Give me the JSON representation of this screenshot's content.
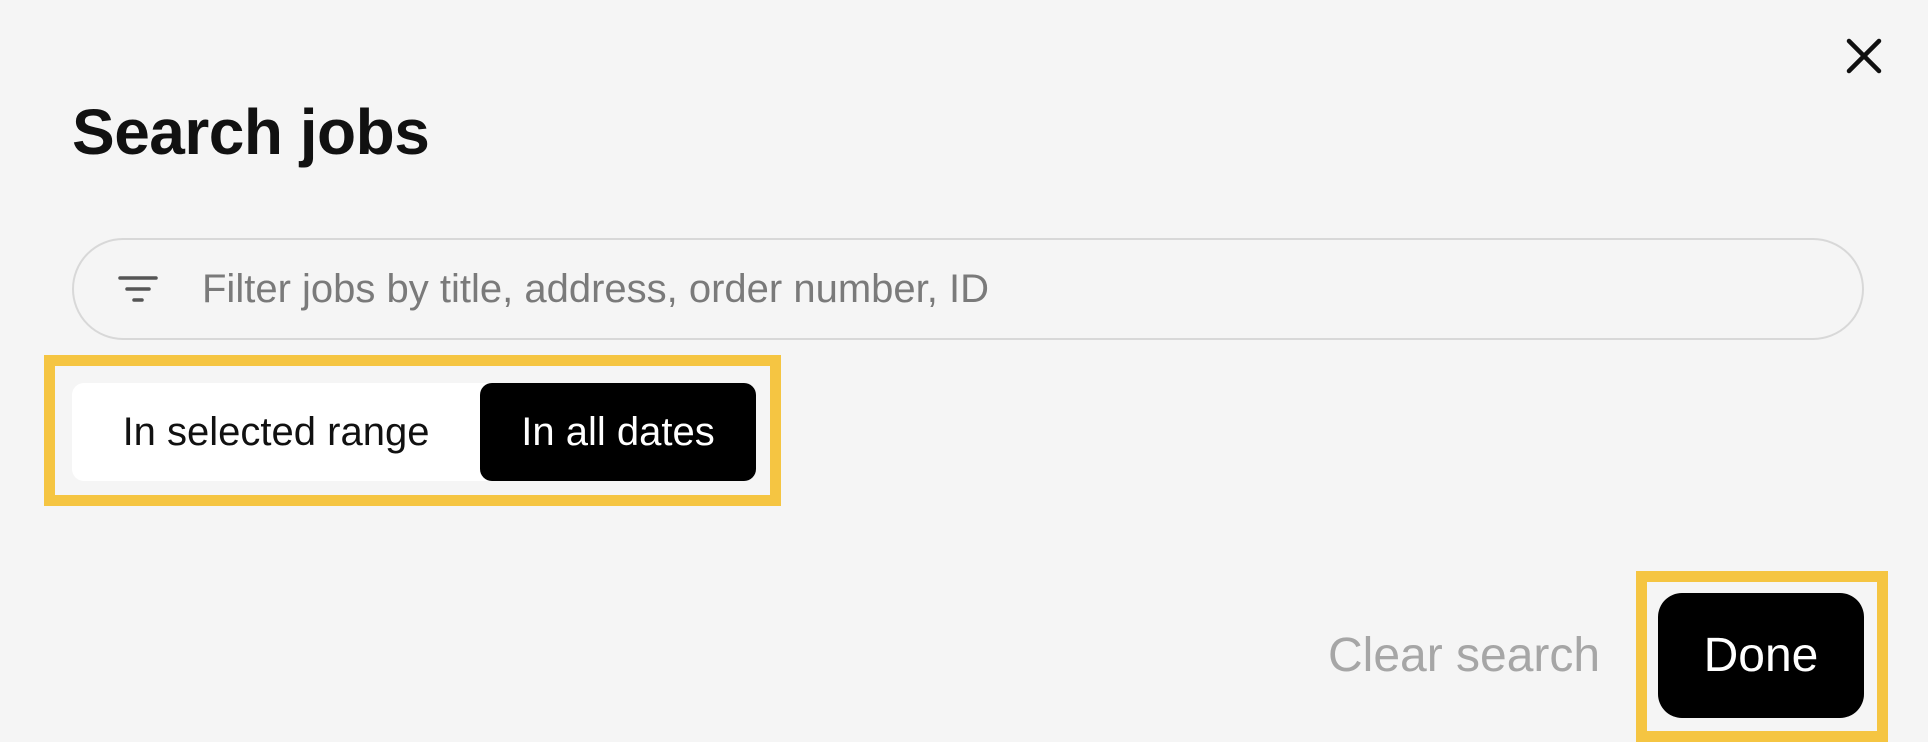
{
  "dialog": {
    "title": "Search jobs",
    "close_icon": "close-icon"
  },
  "search": {
    "placeholder": "Filter jobs by title, address, order number, ID",
    "value": "",
    "icon": "filter-icon"
  },
  "date_scope": {
    "options": [
      {
        "label": "In selected range",
        "selected": false
      },
      {
        "label": "In all dates",
        "selected": true
      }
    ]
  },
  "footer": {
    "clear_label": "Clear search",
    "done_label": "Done"
  },
  "colors": {
    "background": "#f5f5f5",
    "highlight": "#f5c542",
    "selected_bg": "#000000",
    "muted_text": "#a6a6a6"
  }
}
